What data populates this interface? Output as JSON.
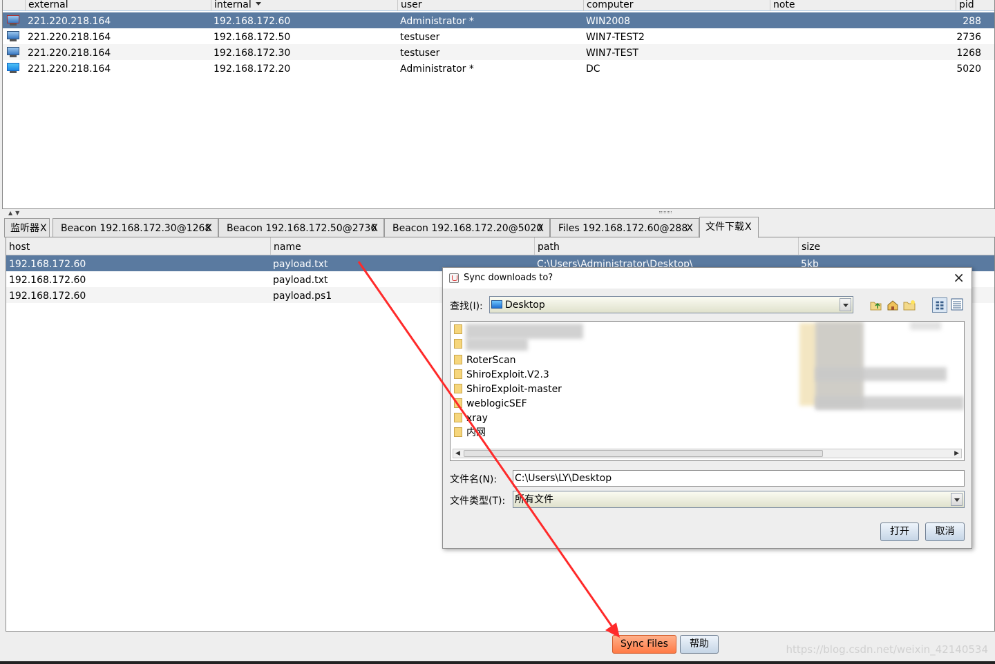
{
  "sessions": {
    "columns": [
      "external",
      "internal",
      "user",
      "computer",
      "note",
      "pid"
    ],
    "rows": [
      {
        "external": "221.220.218.164",
        "internal": "192.168.172.60",
        "user": "Administrator *",
        "computer": "WIN2008",
        "note": "",
        "pid": "288",
        "icon": "server-icon"
      },
      {
        "external": "221.220.218.164",
        "internal": "192.168.172.50",
        "user": "testuser",
        "computer": "WIN7-TEST2",
        "note": "",
        "pid": "2736",
        "icon": "monitor-icon"
      },
      {
        "external": "221.220.218.164",
        "internal": "192.168.172.30",
        "user": "testuser",
        "computer": "WIN7-TEST",
        "note": "",
        "pid": "1268",
        "icon": "monitor-icon"
      },
      {
        "external": "221.220.218.164",
        "internal": "192.168.172.20",
        "user": "Administrator *",
        "computer": "DC",
        "note": "",
        "pid": "5020",
        "icon": "windows-icon"
      }
    ]
  },
  "tabs": [
    {
      "label": "监听器",
      "close": "X"
    },
    {
      "label": "Beacon 192.168.172.30@1268",
      "close": "X"
    },
    {
      "label": "Beacon 192.168.172.50@2736",
      "close": "X"
    },
    {
      "label": "Beacon 192.168.172.20@5020",
      "close": "X"
    },
    {
      "label": "Files 192.168.172.60@288",
      "close": "X"
    },
    {
      "label": "文件下载",
      "close": "X"
    }
  ],
  "downloads": {
    "columns": [
      "host",
      "name",
      "path",
      "size"
    ],
    "rows": [
      {
        "host": "192.168.172.60",
        "name": "payload.txt",
        "path": "C:\\Users\\Administrator\\Desktop\\",
        "size": "5kb"
      },
      {
        "host": "192.168.172.60",
        "name": "payload.txt",
        "path": "",
        "size": ""
      },
      {
        "host": "192.168.172.60",
        "name": "payload.ps1",
        "path": "",
        "size": ""
      }
    ]
  },
  "buttons": {
    "sync": "Sync Files",
    "help": "帮助"
  },
  "watermark": "https://blog.csdn.net/weixin_42140534",
  "dialog": {
    "title": "Sync downloads to?",
    "close": "×",
    "lookin_label": "查找(I):",
    "lookin_value": "Desktop",
    "files": [
      "RoterScan",
      "ShiroExploit.V2.3",
      "ShiroExploit-master",
      "weblogicSEF",
      "xray",
      "内网"
    ],
    "filename_label": "文件名(N):",
    "filename_value": "C:\\Users\\LY\\Desktop",
    "filetype_label": "文件类型(T):",
    "filetype_value": "所有文件",
    "open": "打开",
    "cancel": "取消"
  },
  "colors": {
    "selection": "#5a7aa0",
    "sync_button": "#ff7a45",
    "annotation_arrow": "#ff2a2a"
  }
}
